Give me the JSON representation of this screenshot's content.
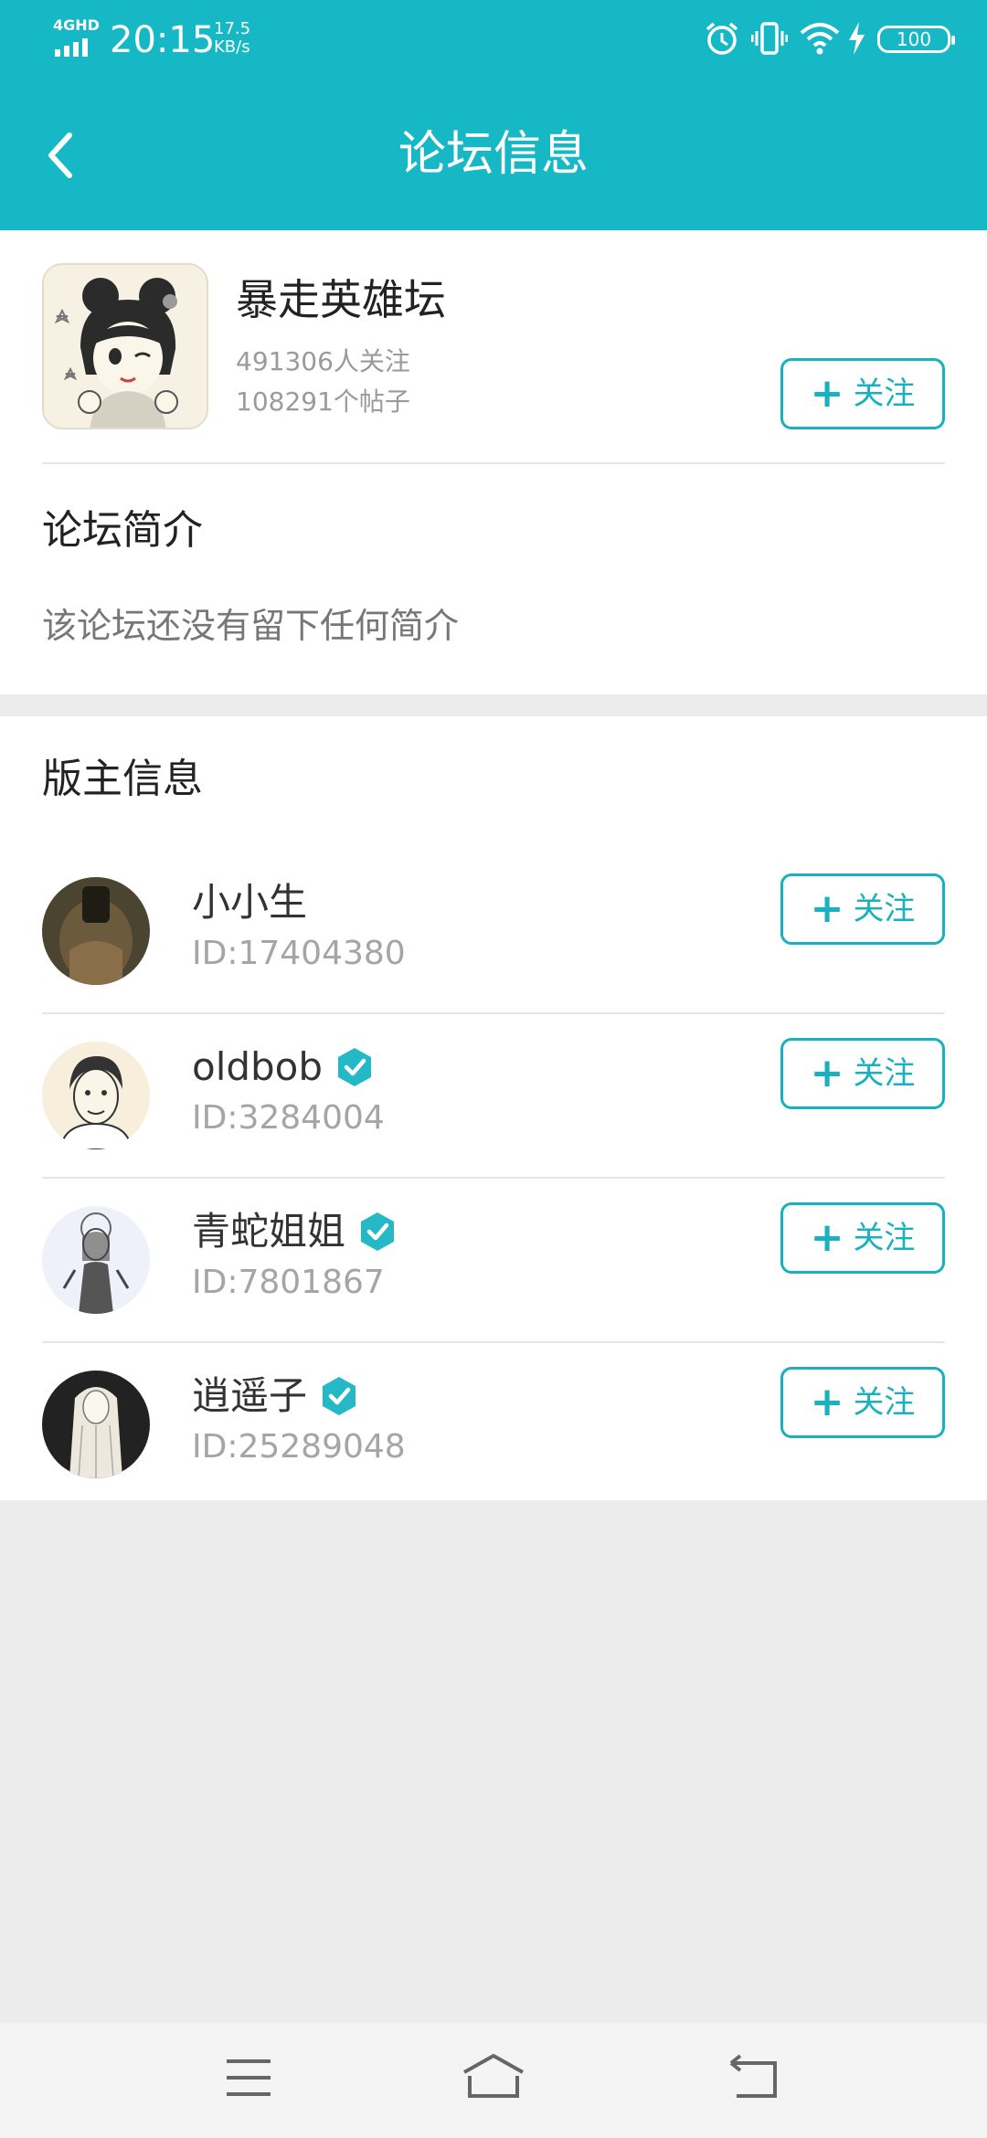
{
  "status_bar": {
    "network": "4GHD",
    "time": "20:15",
    "speed_value": "17.5",
    "speed_unit": "KB/s",
    "battery": "100",
    "icons": [
      "alarm-icon",
      "vibrate-icon",
      "wifi-icon",
      "charging-icon",
      "battery-icon"
    ]
  },
  "header": {
    "title": "论坛信息",
    "back_icon": "chevron-left-icon"
  },
  "forum": {
    "name": "暴走英雄坛",
    "followers": "491306人关注",
    "posts": "108291个帖子",
    "follow_label": "关注"
  },
  "intro": {
    "title": "论坛简介",
    "text": "该论坛还没有留下任何简介"
  },
  "moderators": {
    "title": "版主信息",
    "items": [
      {
        "name": "小小生",
        "id": "ID:17404380",
        "verified": false,
        "follow_label": "关注"
      },
      {
        "name": "oldbob",
        "id": "ID:3284004",
        "verified": true,
        "follow_label": "关注"
      },
      {
        "name": "青蛇姐姐",
        "id": "ID:7801867",
        "verified": true,
        "follow_label": "关注"
      },
      {
        "name": "逍遥子",
        "id": "ID:25289048",
        "verified": true,
        "follow_label": "关注"
      }
    ]
  },
  "nav_bar": {
    "icons": [
      "menu-icon",
      "home-icon",
      "back-nav-icon"
    ]
  },
  "colors": {
    "accent": "#17b8c6",
    "button": "#17b1bf",
    "background": "#ececec"
  }
}
